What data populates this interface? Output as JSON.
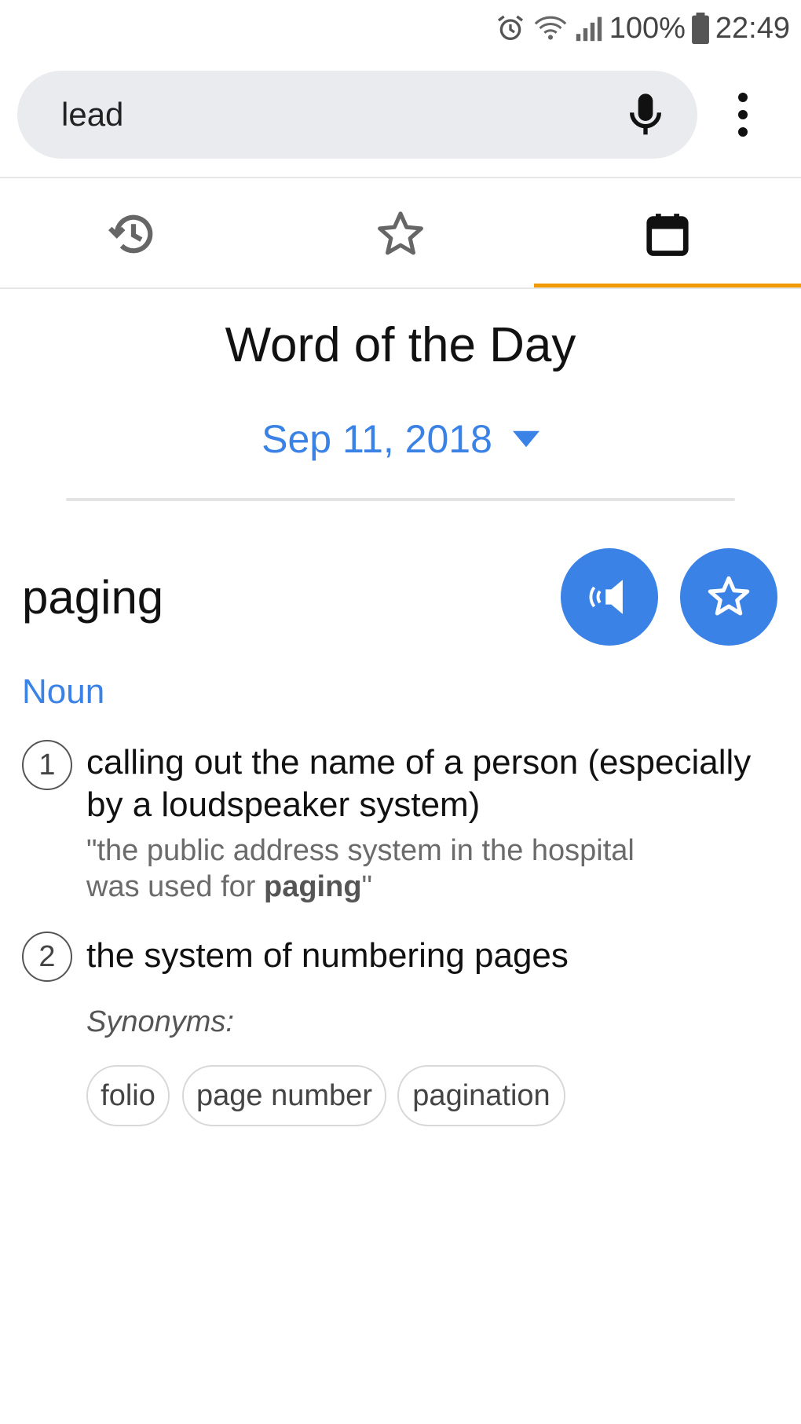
{
  "status_bar": {
    "battery": "100%",
    "time": "22:49"
  },
  "search": {
    "query": "lead"
  },
  "tabs": [
    {
      "name": "history",
      "icon": "history-icon"
    },
    {
      "name": "favorites",
      "icon": "star-icon"
    },
    {
      "name": "word-of-the-day",
      "icon": "calendar-icon",
      "selected": true
    }
  ],
  "page": {
    "title": "Word of the Day",
    "date": "Sep 11, 2018"
  },
  "entry": {
    "word": "paging",
    "part_of_speech": "Noun",
    "definitions": [
      {
        "number": "1",
        "line1": "calling out the name of a person (especially",
        "line2": "by a loudspeaker system)",
        "example_line1": "\"the public address system in the hospital",
        "example_line2_prefix": "was used for ",
        "example_bold": "paging",
        "example_suffix": "\""
      },
      {
        "number": "2",
        "text": "the system of numbering pages",
        "synonyms_label": "Synonyms:",
        "synonyms": [
          "folio",
          "page number",
          "pagination"
        ]
      }
    ]
  },
  "colors": {
    "accent_blue": "#3b82e6",
    "tab_indicator": "#f09a00"
  }
}
